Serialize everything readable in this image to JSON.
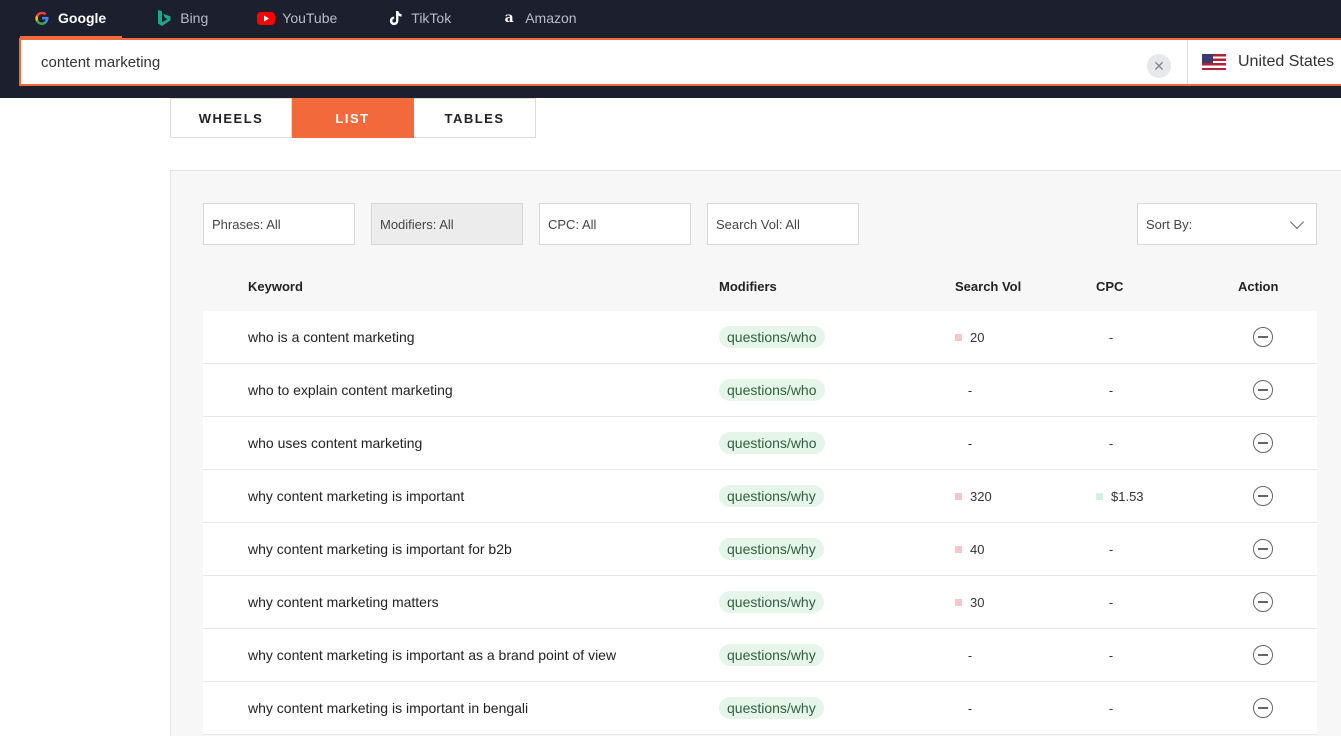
{
  "engines": [
    {
      "label": "Google",
      "icon": "google-icon",
      "active": true
    },
    {
      "label": "Bing",
      "icon": "bing-icon",
      "active": false
    },
    {
      "label": "YouTube",
      "icon": "youtube-icon",
      "active": false
    },
    {
      "label": "TikTok",
      "icon": "tiktok-icon",
      "active": false
    },
    {
      "label": "Amazon",
      "icon": "amazon-icon",
      "active": false
    }
  ],
  "search": {
    "value": "content marketing",
    "clear_icon": "close-icon"
  },
  "country": {
    "label": "United States",
    "flag": "us-flag-icon"
  },
  "view_tabs": [
    {
      "label": "WHEELS",
      "active": false
    },
    {
      "label": "LIST",
      "active": true
    },
    {
      "label": "TABLES",
      "active": false
    }
  ],
  "filters": {
    "phrases": "Phrases: All",
    "modifiers": "Modifiers: All",
    "cpc": "CPC: All",
    "search_vol": "Search Vol: All",
    "sort_by": "Sort By:"
  },
  "table": {
    "headers": {
      "keyword": "Keyword",
      "modifiers": "Modifiers",
      "search_vol": "Search Vol",
      "cpc": "CPC",
      "action": "Action"
    },
    "rows": [
      {
        "keyword": "who is a content marketing",
        "modifier": "questions/who",
        "search_vol": "20",
        "cpc": "-"
      },
      {
        "keyword": "who to explain content marketing",
        "modifier": "questions/who",
        "search_vol": "-",
        "cpc": "-"
      },
      {
        "keyword": "who uses content marketing",
        "modifier": "questions/who",
        "search_vol": "-",
        "cpc": "-"
      },
      {
        "keyword": "why content marketing is important",
        "modifier": "questions/why",
        "search_vol": "320",
        "cpc": "$1.53"
      },
      {
        "keyword": "why content marketing is important for b2b",
        "modifier": "questions/why",
        "search_vol": "40",
        "cpc": "-"
      },
      {
        "keyword": "why content marketing matters",
        "modifier": "questions/why",
        "search_vol": "30",
        "cpc": "-"
      },
      {
        "keyword": "why content marketing is important as a brand point of view",
        "modifier": "questions/why",
        "search_vol": "-",
        "cpc": "-"
      },
      {
        "keyword": "why content marketing is important in bengali",
        "modifier": "questions/why",
        "search_vol": "-",
        "cpc": "-"
      }
    ]
  },
  "colors": {
    "accent": "#f26a3b",
    "topbar": "#1c1f2e",
    "pill_bg": "#e6f5ea",
    "vol_marker": "#f5c7c7",
    "cpc_marker": "#d4f0e0"
  }
}
